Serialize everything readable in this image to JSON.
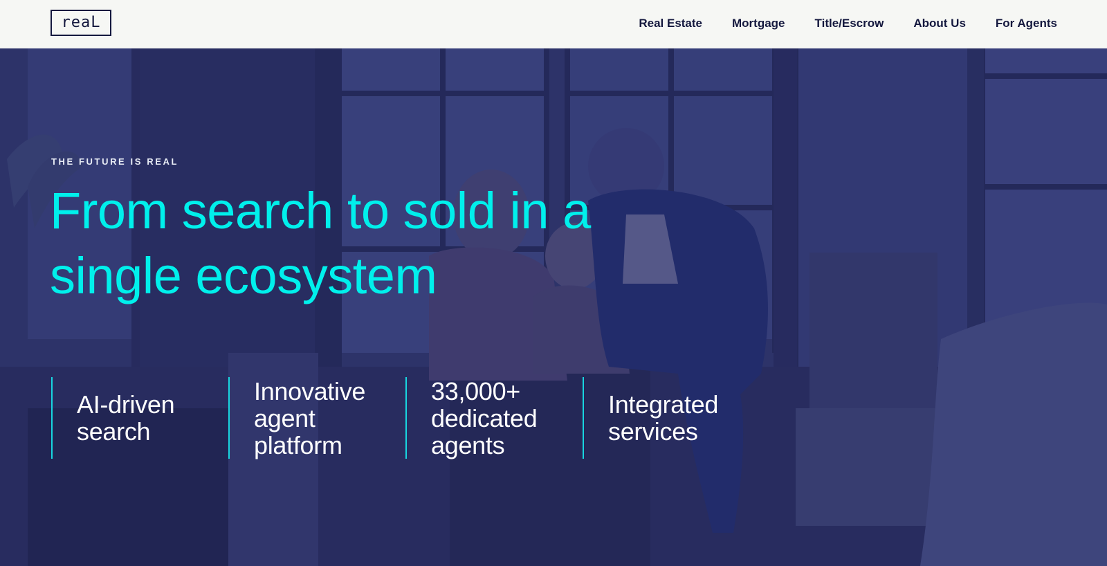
{
  "brand": {
    "logo_text": "reaL"
  },
  "nav": {
    "items": [
      {
        "label": "Real Estate"
      },
      {
        "label": "Mortgage"
      },
      {
        "label": "Title/Escrow"
      },
      {
        "label": "About Us"
      },
      {
        "label": "For Agents"
      }
    ]
  },
  "hero": {
    "eyebrow": "THE FUTURE IS REAL",
    "headline": "From search to sold in a single ecosystem",
    "features": [
      {
        "label": "AI-driven search"
      },
      {
        "label": "Innovative agent platform"
      },
      {
        "label": "33,000+ dedicated agents"
      },
      {
        "label": "Integrated services"
      }
    ]
  },
  "colors": {
    "header_bg": "#f6f7f4",
    "nav_text": "#14183e",
    "hero_bg": "#2c3262",
    "headline": "#00f0ec",
    "feature_divider": "#18d6e0",
    "feature_text": "#ffffff"
  }
}
